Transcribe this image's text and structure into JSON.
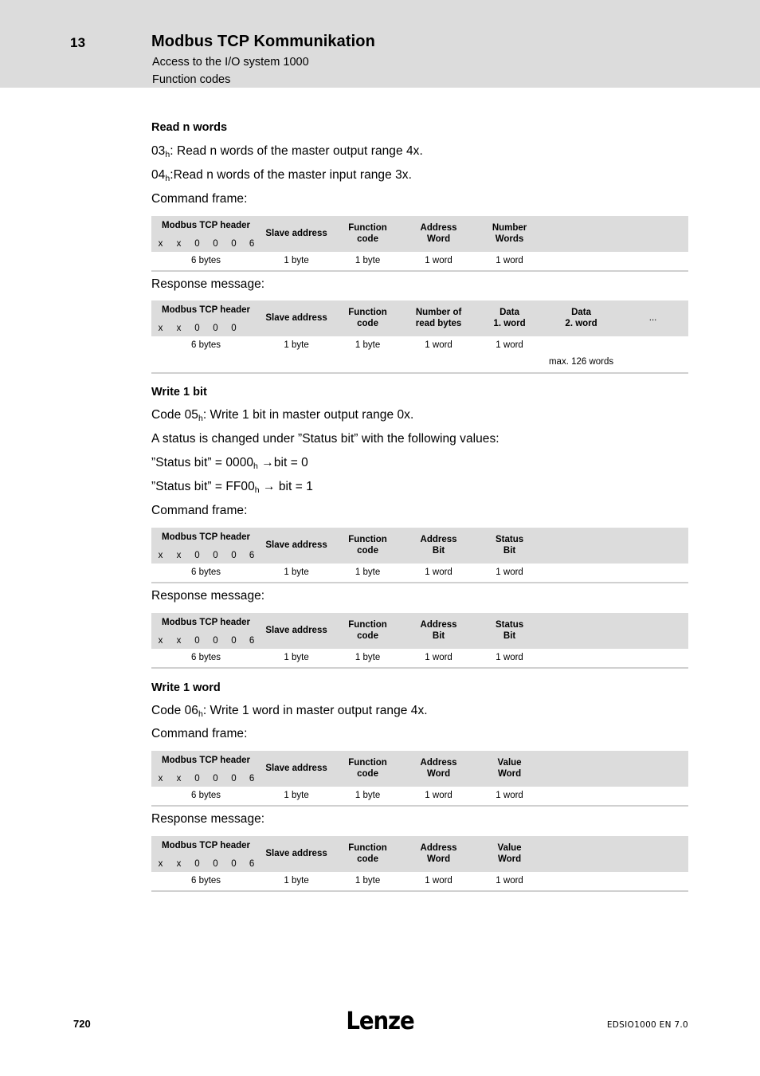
{
  "header": {
    "chapter": "13",
    "title": "Modbus TCP Kommunikation",
    "subtitle1": "Access to the I/O system 1000",
    "subtitle2": "Function codes"
  },
  "sections": [
    {
      "heading": "Read n words",
      "lines": [
        "03h: Read n words of the master output range 4x.",
        "04h:Read n words of the master input range 3x."
      ],
      "line1_main": "03",
      "line1_sub": "h",
      "line1_rest": ": Read n words of the master output range 4x.",
      "line2_main": "04",
      "line2_sub": "h",
      "line2_rest": ":Read n words of the master input range 3x.",
      "command_label": "Command frame:",
      "response_label": "Response message:"
    },
    {
      "heading": "Write 1 bit",
      "code_prefix": "Code 05",
      "code_sub": "h",
      "code_rest": ": Write 1 bit in master output range 0x.",
      "status_intro": "A status is changed under ”Status bit” with the following values:",
      "status_line1_a": "”Status bit” = 0000",
      "status_line1_sub": "h",
      "status_line1_b": " →bit = 0",
      "status_line2_a": "”Status bit” = FF00",
      "status_line2_sub": "h",
      "status_line2_b": " → bit = 1",
      "command_label": "Command frame:",
      "response_label": "Response message:"
    },
    {
      "heading": "Write 1 word",
      "code_prefix": "Code 06",
      "code_sub": "h",
      "code_rest": ": Write 1 word in master output range 4x.",
      "command_label": "Command frame:",
      "response_label": "Response message:"
    }
  ],
  "tables": {
    "read_command": {
      "header_label": "Modbus TCP header",
      "hex": [
        "x",
        "x",
        "0",
        "0",
        "0",
        "6"
      ],
      "columns": [
        {
          "line1": "Slave address",
          "line2": ""
        },
        {
          "line1": "Function",
          "line2": "code"
        },
        {
          "line1": "Address",
          "line2": "Word"
        },
        {
          "line1": "Number",
          "line2": "Words"
        },
        {
          "line1": "",
          "line2": ""
        }
      ],
      "sizes": [
        "6 bytes",
        "1 byte",
        "1 byte",
        "1 word",
        "1 word",
        ""
      ]
    },
    "read_response": {
      "header_label": "Modbus TCP header",
      "hex": [
        "x",
        "x",
        "0",
        "0",
        "0",
        ""
      ],
      "columns": [
        {
          "line1": "Slave address",
          "line2": ""
        },
        {
          "line1": "Function",
          "line2": "code"
        },
        {
          "line1": "Number of",
          "line2": "read bytes"
        },
        {
          "line1": "Data",
          "line2": "1. word"
        },
        {
          "line1": "Data",
          "line2": "2. word"
        },
        {
          "line1": "...",
          "line2": ""
        }
      ],
      "sizes": [
        "6 bytes",
        "1 byte",
        "1 byte",
        "1 word",
        "1 word",
        "",
        ""
      ],
      "extra_note": "max. 126 words"
    },
    "writebit_command": {
      "header_label": "Modbus TCP header",
      "hex": [
        "x",
        "x",
        "0",
        "0",
        "0",
        "6"
      ],
      "columns": [
        {
          "line1": "Slave address",
          "line2": ""
        },
        {
          "line1": "Function",
          "line2": "code"
        },
        {
          "line1": "Address",
          "line2": "Bit"
        },
        {
          "line1": "Status",
          "line2": "Bit"
        },
        {
          "line1": "",
          "line2": ""
        }
      ],
      "sizes": [
        "6 bytes",
        "1 byte",
        "1 byte",
        "1 word",
        "1 word",
        ""
      ]
    },
    "writebit_response": {
      "header_label": "Modbus TCP header",
      "hex": [
        "x",
        "x",
        "0",
        "0",
        "0",
        "6"
      ],
      "columns": [
        {
          "line1": "Slave address",
          "line2": ""
        },
        {
          "line1": "Function",
          "line2": "code"
        },
        {
          "line1": "Address",
          "line2": "Bit"
        },
        {
          "line1": "Status",
          "line2": "Bit"
        },
        {
          "line1": "",
          "line2": ""
        }
      ],
      "sizes": [
        "6 bytes",
        "1 byte",
        "1 byte",
        "1 word",
        "1 word",
        ""
      ]
    },
    "writeword_command": {
      "header_label": "Modbus TCP header",
      "hex": [
        "x",
        "x",
        "0",
        "0",
        "0",
        "6"
      ],
      "columns": [
        {
          "line1": "Slave address",
          "line2": ""
        },
        {
          "line1": "Function",
          "line2": "code"
        },
        {
          "line1": "Address",
          "line2": "Word"
        },
        {
          "line1": "Value",
          "line2": "Word"
        },
        {
          "line1": "",
          "line2": ""
        }
      ],
      "sizes": [
        "6 bytes",
        "1 byte",
        "1 byte",
        "1 word",
        "1 word",
        ""
      ]
    },
    "writeword_response": {
      "header_label": "Modbus TCP header",
      "hex": [
        "x",
        "x",
        "0",
        "0",
        "0",
        "6"
      ],
      "columns": [
        {
          "line1": "Slave address",
          "line2": ""
        },
        {
          "line1": "Function",
          "line2": "code"
        },
        {
          "line1": "Address",
          "line2": "Word"
        },
        {
          "line1": "Value",
          "line2": "Word"
        },
        {
          "line1": "",
          "line2": ""
        },
        {
          "line1": "",
          "line2": ""
        }
      ],
      "sizes": [
        "6 bytes",
        "1 byte",
        "1 byte",
        "1 word",
        "1 word",
        "",
        ""
      ]
    }
  },
  "footer": {
    "page_number": "720",
    "logo": "Lenze",
    "document_id": "EDSIO1000 EN 7.0"
  },
  "colors": {
    "band_gray": "#dcdcdc",
    "cell_gray": "#dcdcdc",
    "rule_gray": "#d0d0d0"
  }
}
